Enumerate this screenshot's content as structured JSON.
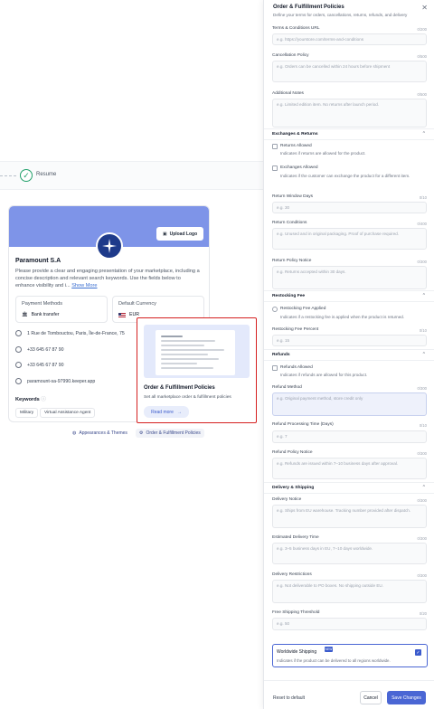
{
  "resume": {
    "label": "Resume"
  },
  "profile": {
    "upload_logo_label": "Upload Logo",
    "brand_name": "Paramount S.A",
    "description": "Please provide a clear and engaging presentation of your marketplace, including a concise description and relevant search keywords. Use the fields below to enhance visibility and i...",
    "show_more": "Show More",
    "payment_methods_title": "Payment Methods",
    "payment_methods_value": "Bank transfer",
    "default_currency_title": "Default Currency",
    "default_currency_value": "EUR",
    "address": "1 Rue de Tombouctou, Paris, Île-de-France, 75",
    "phone1": "+33 645 67 87 90",
    "phone2": "+33 645 67 87 90",
    "website": "paramount-sa-97990.keeper.app",
    "keywords_title": "Keywords",
    "keywords": [
      "Military",
      "Virtual Assistance Agent"
    ]
  },
  "bottom_tabs": {
    "appearance": "Appearances & Themes",
    "policies": "Order & Fulfillment Policies"
  },
  "popup": {
    "title": "Order & Fulfillment Policies",
    "description": "Set all marketplace order & fulfillment policies",
    "read_more": "Read more"
  },
  "panel": {
    "title": "Order & Fulfillment Policies",
    "subtitle": "Define your terms for orders, cancellations, returns, refunds, and delivery",
    "terms_label": "Terms & Conditions URL",
    "terms_count": "0/200",
    "terms_placeholder": "e.g. https://yourstore.com/terms-and-conditions",
    "cancel_label": "Cancellation Policy",
    "cancel_count": "0/500",
    "cancel_placeholder": "e.g. Orders can be cancelled within 24 hours before shipment",
    "notes_label": "Additional Notes",
    "notes_count": "0/500",
    "notes_placeholder": "e.g. Limited edition item. No returns after launch period.",
    "exchanges_section": "Exchanges & Returns",
    "returns_allowed": "Returns Allowed",
    "returns_allowed_desc": "Indicates if returns are allowed for the product.",
    "exchanges_allowed": "Exchanges Allowed",
    "exchanges_allowed_desc": "Indicates if the customer can exchange the product for a different item.",
    "return_window_label": "Return Window Days",
    "return_window_count": "0/10",
    "return_window_placeholder": "e.g. 30",
    "return_conditions_label": "Return Conditions",
    "return_conditions_count": "0/400",
    "return_conditions_placeholder": "e.g. Unused and in original packaging. Proof of purchase required.",
    "return_policy_label": "Return Policy Notice",
    "return_policy_count": "0/300",
    "return_policy_placeholder": "e.g. Returns accepted within 30 days.",
    "restocking_section": "Restocking Fee",
    "restocking_applied": "Restocking Fee Applied",
    "restocking_applied_desc": "Indicates if a restocking fee is applied when the product is returned.",
    "restocking_percent_label": "Restocking Fee Percent",
    "restocking_percent_count": "0/10",
    "restocking_percent_placeholder": "e.g. 15",
    "refunds_section": "Refunds",
    "refunds_allowed": "Refunds Allowed",
    "refunds_allowed_desc": "Indicates if refunds are allowed for this product.",
    "refund_method_label": "Refund Method",
    "refund_method_count": "0/300",
    "refund_method_placeholder": "e.g. Original payment method, store credit only",
    "refund_time_label": "Refund Processing Time (Days)",
    "refund_time_count": "0/10",
    "refund_time_placeholder": "e.g. 7",
    "refund_notice_label": "Refund Policy Notice",
    "refund_notice_count": "0/300",
    "refund_notice_placeholder": "e.g. Refunds are issued within 7–10 business days after approval.",
    "delivery_section": "Delivery & Shipping",
    "delivery_notice_label": "Delivery Notice",
    "delivery_notice_count": "0/300",
    "delivery_notice_placeholder": "e.g. Ships from EU warehouse. Tracking number provided after dispatch.",
    "delivery_time_label": "Estimated Delivery Time",
    "delivery_time_count": "0/300",
    "delivery_time_placeholder": "e.g. 3–5 business days in EU, 7–10 days worldwide.",
    "delivery_restrictions_label": "Delivery Restrictions",
    "delivery_restrictions_count": "0/300",
    "delivery_restrictions_placeholder": "e.g. Not deliverable to PO boxes. No shipping outside EU.",
    "free_shipping_label": "Free Shipping Threshold",
    "free_shipping_count": "0/20",
    "free_shipping_placeholder": "e.g. 50",
    "worldwide_label": "Worldwide Shipping",
    "worldwide_tag": "NEW",
    "worldwide_desc": "Indicates if the product can be delivered to all regions worldwide.",
    "reset_label": "Reset to default",
    "cancel_button": "Cancel",
    "save_button": "Save Changes"
  }
}
